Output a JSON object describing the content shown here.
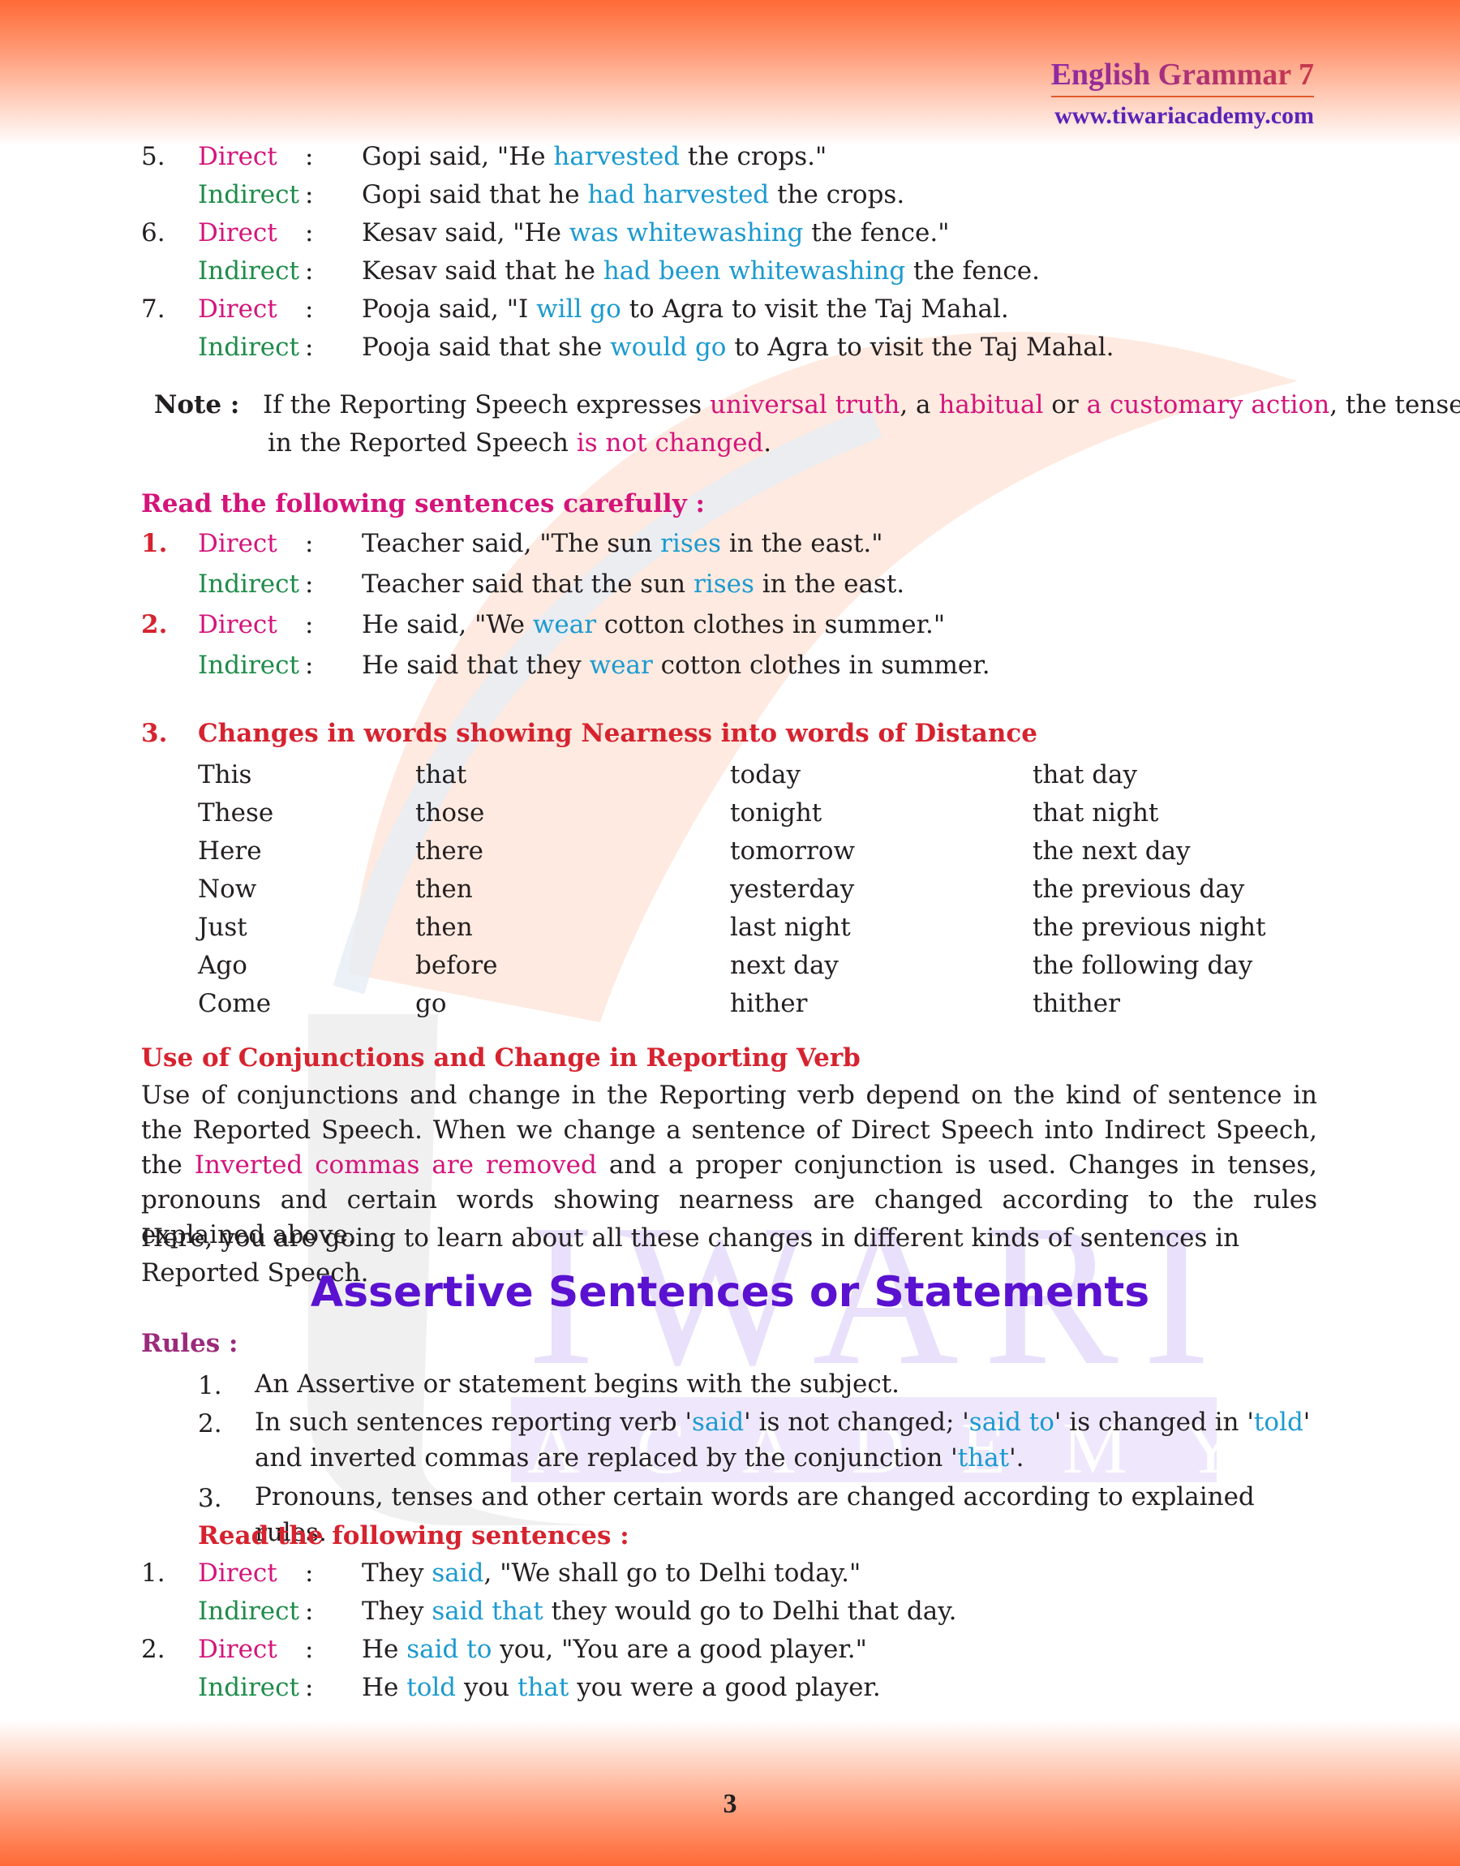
{
  "header": {
    "title": "English Grammar 7",
    "url": "www.tiwariacademy.com"
  },
  "colon": ":",
  "examples_top": [
    {
      "num": "5.",
      "direct_label": "Direct",
      "indirect_label": "Indirect",
      "direct": [
        {
          "t": "Gopi said, \"He "
        },
        {
          "t": "harvested",
          "hl": true
        },
        {
          "t": " the crops.\""
        }
      ],
      "indirect": [
        {
          "t": "Gopi said that he "
        },
        {
          "t": "had harvested",
          "hl": true
        },
        {
          "t": " the crops."
        }
      ]
    },
    {
      "num": "6.",
      "direct_label": "Direct",
      "indirect_label": "Indirect",
      "direct": [
        {
          "t": "Kesav said, \"He "
        },
        {
          "t": "was whitewashing",
          "hl": true
        },
        {
          "t": " the fence.\""
        }
      ],
      "indirect": [
        {
          "t": "Kesav said that he "
        },
        {
          "t": "had been whitewashing",
          "hl": true
        },
        {
          "t": " the fence."
        }
      ]
    },
    {
      "num": "7.",
      "direct_label": "Direct",
      "indirect_label": "Indirect",
      "direct": [
        {
          "t": "Pooja said, \"I "
        },
        {
          "t": "will go",
          "hl": true
        },
        {
          "t": " to Agra to visit the Taj Mahal."
        }
      ],
      "indirect": [
        {
          "t": "Pooja said that she "
        },
        {
          "t": "would go",
          "hl": true
        },
        {
          "t": " to Agra to visit the Taj Mahal."
        }
      ]
    }
  ],
  "note": {
    "label": "Note",
    "line1": [
      {
        "t": "If the Reporting Speech expresses "
      },
      {
        "t": "universal truth",
        "pk": true
      },
      {
        "t": ", a "
      },
      {
        "t": "habitual",
        "pk": true
      },
      {
        "t": " or "
      },
      {
        "t": "a customary action",
        "pk": true
      },
      {
        "t": ", the tense"
      }
    ],
    "line2": [
      {
        "t": "in the Reported Speech "
      },
      {
        "t": "is not changed",
        "pk": true
      },
      {
        "t": "."
      }
    ]
  },
  "read_carefully": {
    "heading": "Read the following sentences carefully :",
    "items": [
      {
        "num": "1.",
        "direct_label": "Direct",
        "indirect_label": "Indirect",
        "direct": [
          {
            "t": "Teacher said, \"The sun "
          },
          {
            "t": "rises",
            "hl": true
          },
          {
            "t": " in the east.\""
          }
        ],
        "indirect": [
          {
            "t": "Teacher said that the sun "
          },
          {
            "t": "rises",
            "hl": true
          },
          {
            "t": " in the east."
          }
        ]
      },
      {
        "num": "2.",
        "direct_label": "Direct",
        "indirect_label": "Indirect",
        "direct": [
          {
            "t": "He said, \"We "
          },
          {
            "t": "wear",
            "hl": true
          },
          {
            "t": " cotton clothes in summer.\""
          }
        ],
        "indirect": [
          {
            "t": "He said that they "
          },
          {
            "t": "wear",
            "hl": true
          },
          {
            "t": " cotton clothes in summer."
          }
        ]
      }
    ]
  },
  "nearness": {
    "num": "3.",
    "heading": "Changes in words showing Nearness into words of Distance",
    "rows": [
      [
        "This",
        "that",
        "today",
        "that day"
      ],
      [
        "These",
        "those",
        "tonight",
        "that night"
      ],
      [
        "Here",
        "there",
        "tomorrow",
        "the next day"
      ],
      [
        "Now",
        "then",
        "yesterday",
        "the previous day"
      ],
      [
        "Just",
        "then",
        "last night",
        "the previous night"
      ],
      [
        "Ago",
        "before",
        "next day",
        "the following day"
      ],
      [
        "Come",
        "go",
        "hither",
        "thither"
      ]
    ]
  },
  "conjunctions": {
    "heading": "Use of Conjunctions and Change in Reporting Verb",
    "para1": [
      {
        "t": "Use of conjunctions and change in the Reporting verb depend on the kind of sentence in the Reported Speech. When we change a sentence of Direct Speech into Indirect Speech, the "
      },
      {
        "t": "Inverted commas are removed",
        "pk": true
      },
      {
        "t": " and a proper conjunction is used. Changes in tenses, pronouns and certain words showing nearness are changed according to the rules explained above."
      }
    ],
    "para2": "Here, you are going to learn about all these changes in different kinds of sentences in Reported Speech."
  },
  "assertive": {
    "title": "Assertive Sentences or Statements",
    "rules_heading": "Rules :",
    "rules": [
      {
        "num": "1.",
        "text": [
          {
            "t": "An Assertive or statement begins with the subject."
          }
        ]
      },
      {
        "num": "2.",
        "text": [
          {
            "t": "In such sentences reporting verb '"
          },
          {
            "t": "said",
            "hl": true
          },
          {
            "t": "' is not changed; '"
          },
          {
            "t": "said to",
            "hl": true
          },
          {
            "t": "' is changed in '"
          },
          {
            "t": "told",
            "hl": true
          },
          {
            "t": "' and inverted commas are replaced by the conjunction '"
          },
          {
            "t": "that",
            "hl": true
          },
          {
            "t": "'."
          }
        ]
      },
      {
        "num": "3.",
        "text": [
          {
            "t": "Pronouns, tenses and other certain words are changed according to explained rules."
          }
        ]
      }
    ],
    "read_heading": "Read the following sentences :",
    "examples": [
      {
        "num": "1.",
        "direct_label": "Direct",
        "indirect_label": "Indirect",
        "direct": [
          {
            "t": "They "
          },
          {
            "t": "said",
            "hl": true
          },
          {
            "t": ", \"We shall go to Delhi today.\""
          }
        ],
        "indirect": [
          {
            "t": "They "
          },
          {
            "t": "said that",
            "hl": true
          },
          {
            "t": " they would go to Delhi that day."
          }
        ]
      },
      {
        "num": "2.",
        "direct_label": "Direct",
        "indirect_label": "Indirect",
        "direct": [
          {
            "t": "He "
          },
          {
            "t": "said to",
            "hl": true
          },
          {
            "t": " you, \"You are a good player.\""
          }
        ],
        "indirect": [
          {
            "t": "He "
          },
          {
            "t": "told",
            "hl": true
          },
          {
            "t": " you "
          },
          {
            "t": "that",
            "hl": true
          },
          {
            "t": " you were a good player."
          }
        ]
      }
    ]
  },
  "footer": {
    "page_number": "3"
  },
  "colors": {
    "direct": "#d4147a",
    "indirect": "#1e8c4a",
    "highlight": "#1b9ad0",
    "heading_red": "#d6232f",
    "title_purple": "#5a12d0"
  }
}
